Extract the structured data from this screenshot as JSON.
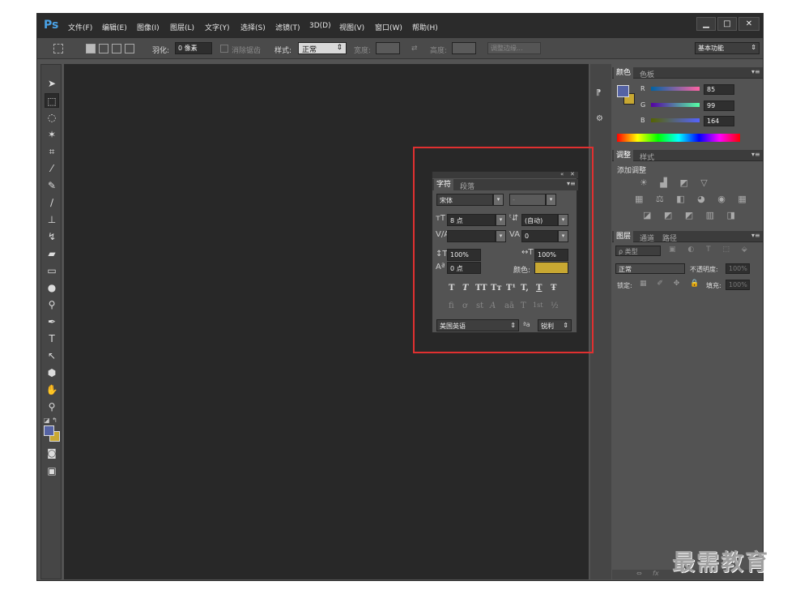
{
  "app": {
    "logo": "Ps"
  },
  "menu": [
    "文件(F)",
    "编辑(E)",
    "图像(I)",
    "图层(L)",
    "文字(Y)",
    "选择(S)",
    "滤镜(T)",
    "3D(D)",
    "视图(V)",
    "窗口(W)",
    "帮助(H)"
  ],
  "window_controls": {
    "minimize": "▁",
    "maximize": "□",
    "close": "✕"
  },
  "options": {
    "feather_label": "羽化:",
    "feather_value": "0 像素",
    "antialias_label": "消除锯齿",
    "style_label": "样式:",
    "style_value": "正常",
    "width_label": "宽度:",
    "height_label": "高度:",
    "refine_edge": "调整边缘...",
    "workspace": "基本功能"
  },
  "color_panel": {
    "tabs": [
      "颜色",
      "色板"
    ],
    "r_label": "R",
    "r_value": "85",
    "g_label": "G",
    "g_value": "99",
    "b_label": "B",
    "b_value": "164",
    "foreground": "#5563a4",
    "background": "#c8a832"
  },
  "adjust_panel": {
    "tabs": [
      "调整",
      "样式"
    ],
    "title": "添加调整"
  },
  "layers_panel": {
    "tabs": [
      "图层",
      "通道",
      "路径"
    ],
    "filter_label": "ρ 类型",
    "blend_mode": "正常",
    "opacity_label": "不透明度:",
    "opacity_value": "100%",
    "lock_label": "锁定:",
    "fill_label": "填充:",
    "fill_value": "100%"
  },
  "character_panel": {
    "tabs": [
      "字符",
      "段落"
    ],
    "font_family": "宋体",
    "font_style": "-",
    "font_size": "8 点",
    "leading": "(自动)",
    "kerning": "",
    "tracking": "0",
    "vertical_scale": "100%",
    "horizontal_scale": "100%",
    "baseline_shift": "0 点",
    "color_label": "颜色:",
    "text_color": "#c8a832",
    "style_buttons": [
      "T",
      "T",
      "TT",
      "Tт",
      "T¹",
      "T,",
      "T",
      "Ŧ"
    ],
    "opentype_buttons": [
      "fi",
      "ơ",
      "st",
      "A",
      "aā",
      "T",
      "1st",
      "½"
    ],
    "language": "美国英语",
    "aa_label": "ªa",
    "antialias": "锐利"
  },
  "watermark": "最需教育"
}
